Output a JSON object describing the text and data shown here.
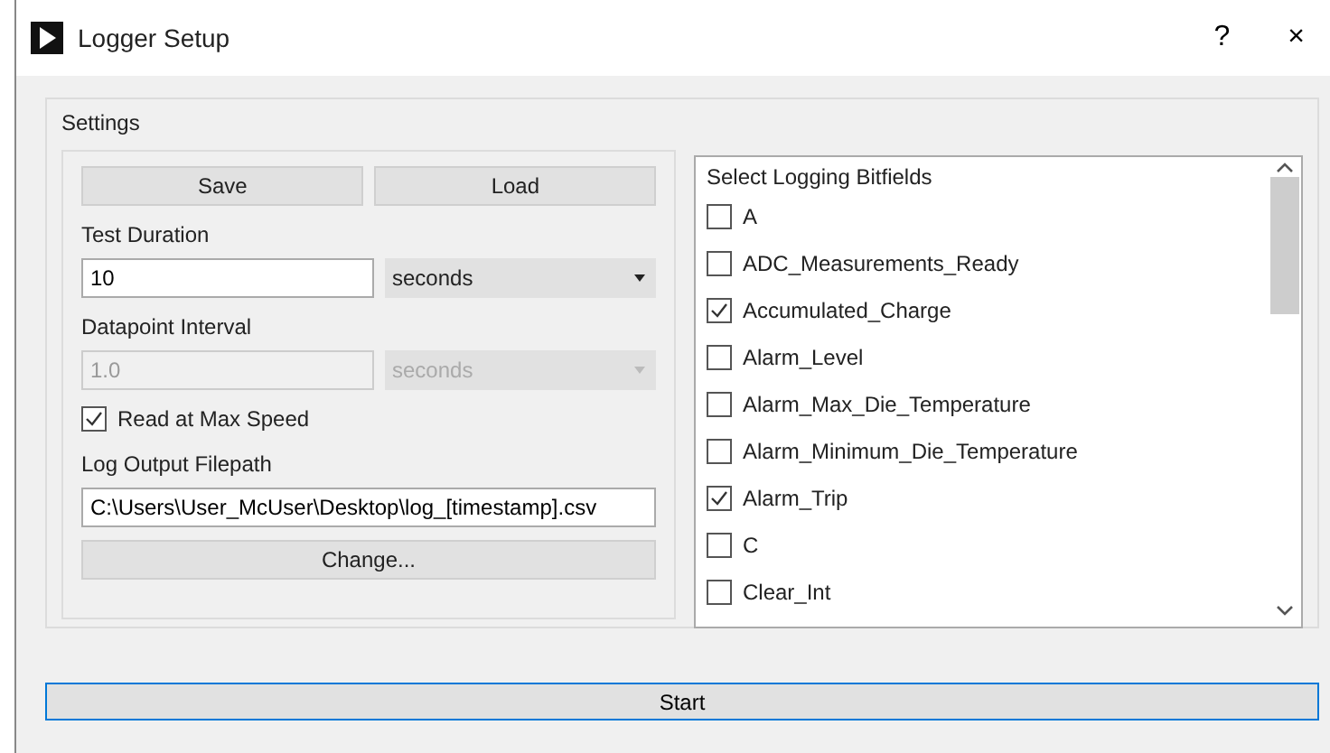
{
  "window": {
    "title": "Logger Setup",
    "help": "?",
    "close": "×"
  },
  "settings": {
    "title": "Settings",
    "buttons": [
      "Save",
      "Load"
    ],
    "test_duration": {
      "label": "Test Duration",
      "value": "10",
      "unit": "seconds",
      "disabled": false
    },
    "datapoint_interval": {
      "label": "Datapoint Interval",
      "value": "1.0",
      "unit": "seconds",
      "disabled": true
    },
    "read_max_speed": {
      "label": "Read at Max Speed",
      "checked": true
    },
    "filepath": {
      "label": "Log Output Filepath",
      "value": "C:\\Users\\User_McUser\\Desktop\\log_[timestamp].csv"
    },
    "change_button": "Change..."
  },
  "bitfields": {
    "title": "Select Logging Bitfields",
    "items": [
      {
        "label": "A",
        "checked": false
      },
      {
        "label": "ADC_Measurements_Ready",
        "checked": false
      },
      {
        "label": "Accumulated_Charge",
        "checked": true
      },
      {
        "label": "Alarm_Level",
        "checked": false
      },
      {
        "label": "Alarm_Max_Die_Temperature",
        "checked": false
      },
      {
        "label": "Alarm_Minimum_Die_Temperature",
        "checked": false
      },
      {
        "label": "Alarm_Trip",
        "checked": true
      },
      {
        "label": "C",
        "checked": false
      },
      {
        "label": "Clear_Int",
        "checked": false
      }
    ]
  },
  "start_button": "Start"
}
